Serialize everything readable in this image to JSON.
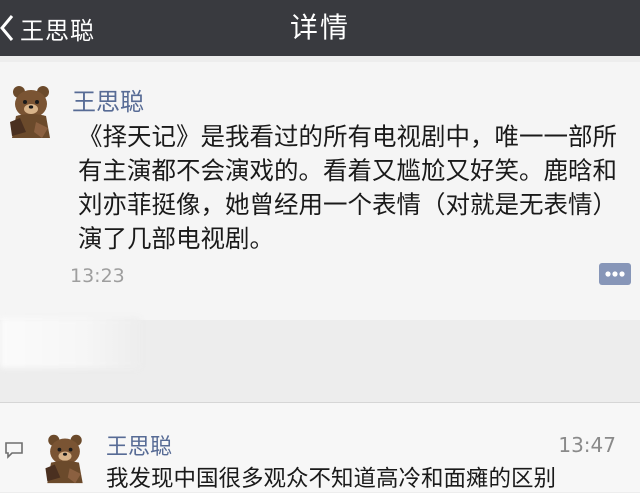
{
  "header": {
    "back_label": "王思聪",
    "title": "详情"
  },
  "post": {
    "author": "王思聪",
    "content": "《择天记》是我看过的所有电视剧中，唯一一部所有主演都不会演戏的。看着又尴尬又好笑。鹿晗和刘亦菲挺像，她曾经用一个表情（对就是无表情）演了几部电视剧。",
    "time": "13:23"
  },
  "comment": {
    "author": "王思聪",
    "time": "13:47",
    "text": "我发现中国很多观众不知道高冷和面瘫的区别"
  },
  "icons": {
    "back": "chevron-left-icon",
    "avatar": "brown-bear-avatar",
    "comment_button": "comment-dots-icon",
    "comment_bubble": "speech-bubble-icon"
  },
  "colors": {
    "nav_bg": "#393a3f",
    "name_link": "#576b95",
    "time_gray": "#9e9e9e"
  }
}
